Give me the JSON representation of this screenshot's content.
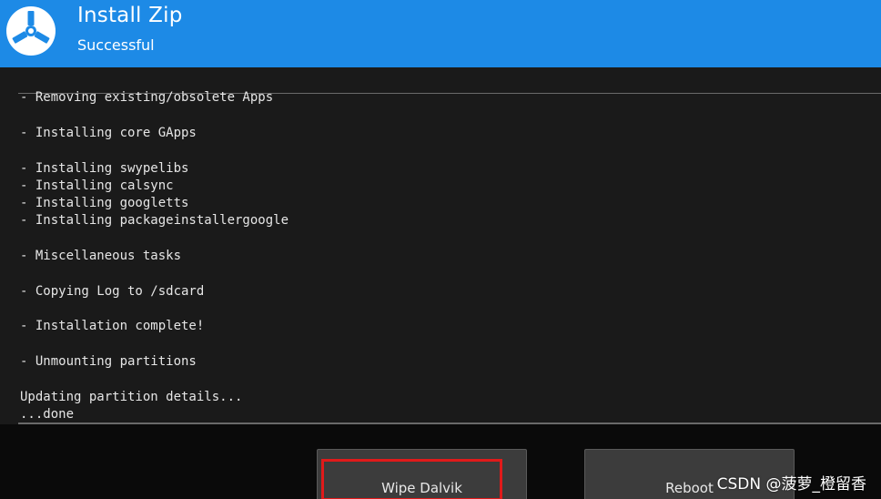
{
  "header": {
    "title": "Install Zip",
    "subtitle": "Successful",
    "logo_icon": "twrp-logo-icon",
    "color": "#1d8ae6"
  },
  "console": {
    "lines": [
      "- Removing existing/obsolete Apps",
      "- Installing core GApps",
      "- Installing swypelibs",
      "- Installing calsync",
      "- Installing googletts",
      "- Installing packageinstallergoogle",
      "- Miscellaneous tasks",
      "- Copying Log to /sdcard",
      "- Installation complete!",
      "- Unmounting partitions",
      "Updating partition details...",
      "...done"
    ]
  },
  "buttons": {
    "wipe_dalvik": "Wipe Dalvik",
    "reboot": "Reboot"
  },
  "annotation": {
    "highlight_color": "#e01a1a"
  },
  "watermark": "CSDN @菠萝_橙留香"
}
